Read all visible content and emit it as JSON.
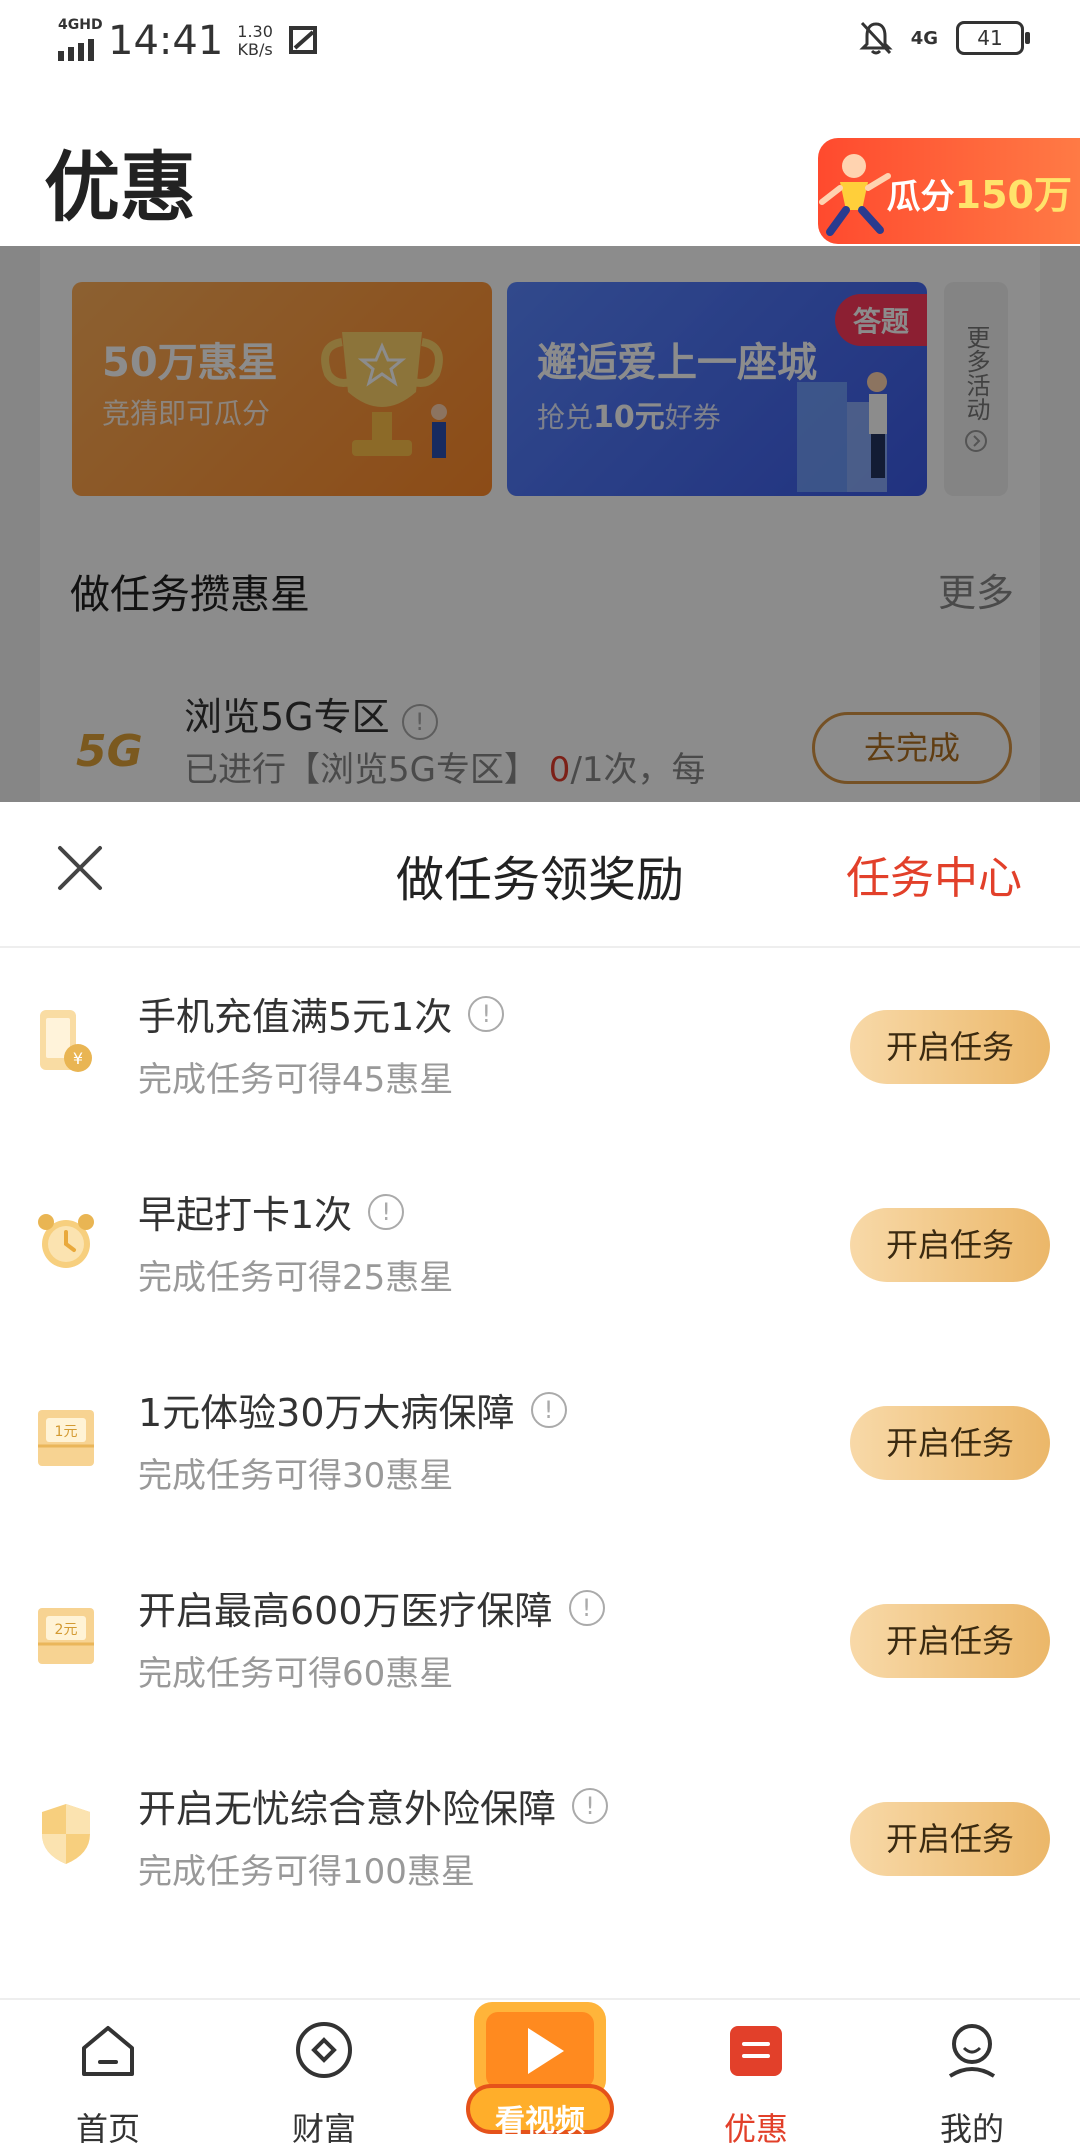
{
  "status_bar": {
    "network": "4GHD",
    "time": "14:41",
    "speed_value": "1.30",
    "speed_unit": "KB/s",
    "network_right": "4G",
    "battery": "41"
  },
  "header": {
    "title": "优惠",
    "promo_prefix": "瓜分",
    "promo_amount": "150万"
  },
  "background": {
    "banners": [
      {
        "title": "50万惠星",
        "subtitle": "竞猜即可瓜分"
      },
      {
        "title": "邂逅爱上一座城",
        "subtitle_prefix": "抢兑",
        "subtitle_bold": "10元",
        "subtitle_suffix": "好券",
        "badge": "答题"
      }
    ],
    "more_activities": "更多活动",
    "section_title": "做任务攒惠星",
    "section_more": "更多",
    "task": {
      "name": "浏览5G专区",
      "progress_prefix": "已进行【浏览5G专区】",
      "progress_done": "0",
      "progress_suffix": "/1次，每",
      "button": "去完成",
      "logo": "5G"
    }
  },
  "sheet": {
    "title": "做任务领奖励",
    "task_center": "任务中心",
    "tasks": [
      {
        "name": "手机充值满5元1次",
        "reward": "完成任务可得45惠星",
        "button": "开启任务",
        "icon": "phone-topup-icon"
      },
      {
        "name": "早起打卡1次",
        "reward": "完成任务可得25惠星",
        "button": "开启任务",
        "icon": "alarm-clock-icon"
      },
      {
        "name": "1元体验30万大病保障",
        "reward": "完成任务可得30惠星",
        "button": "开启任务",
        "icon": "one-yuan-ticket-icon",
        "icon_text": "1元"
      },
      {
        "name": "开启最高600万医疗保障",
        "reward": "完成任务可得60惠星",
        "button": "开启任务",
        "icon": "two-yuan-ticket-icon",
        "icon_text": "2元"
      },
      {
        "name": "开启无忧综合意外险保障",
        "reward": "完成任务可得100惠星",
        "button": "开启任务",
        "icon": "shield-icon"
      }
    ]
  },
  "tabbar": {
    "items": [
      {
        "label": "首页"
      },
      {
        "label": "财富"
      },
      {
        "label": "看视频"
      },
      {
        "label": "优惠",
        "active": true
      },
      {
        "label": "我的"
      }
    ],
    "active_color": "#e2402a"
  },
  "colors": {
    "accent": "#e2402a",
    "button_gold": "#ebb769"
  }
}
